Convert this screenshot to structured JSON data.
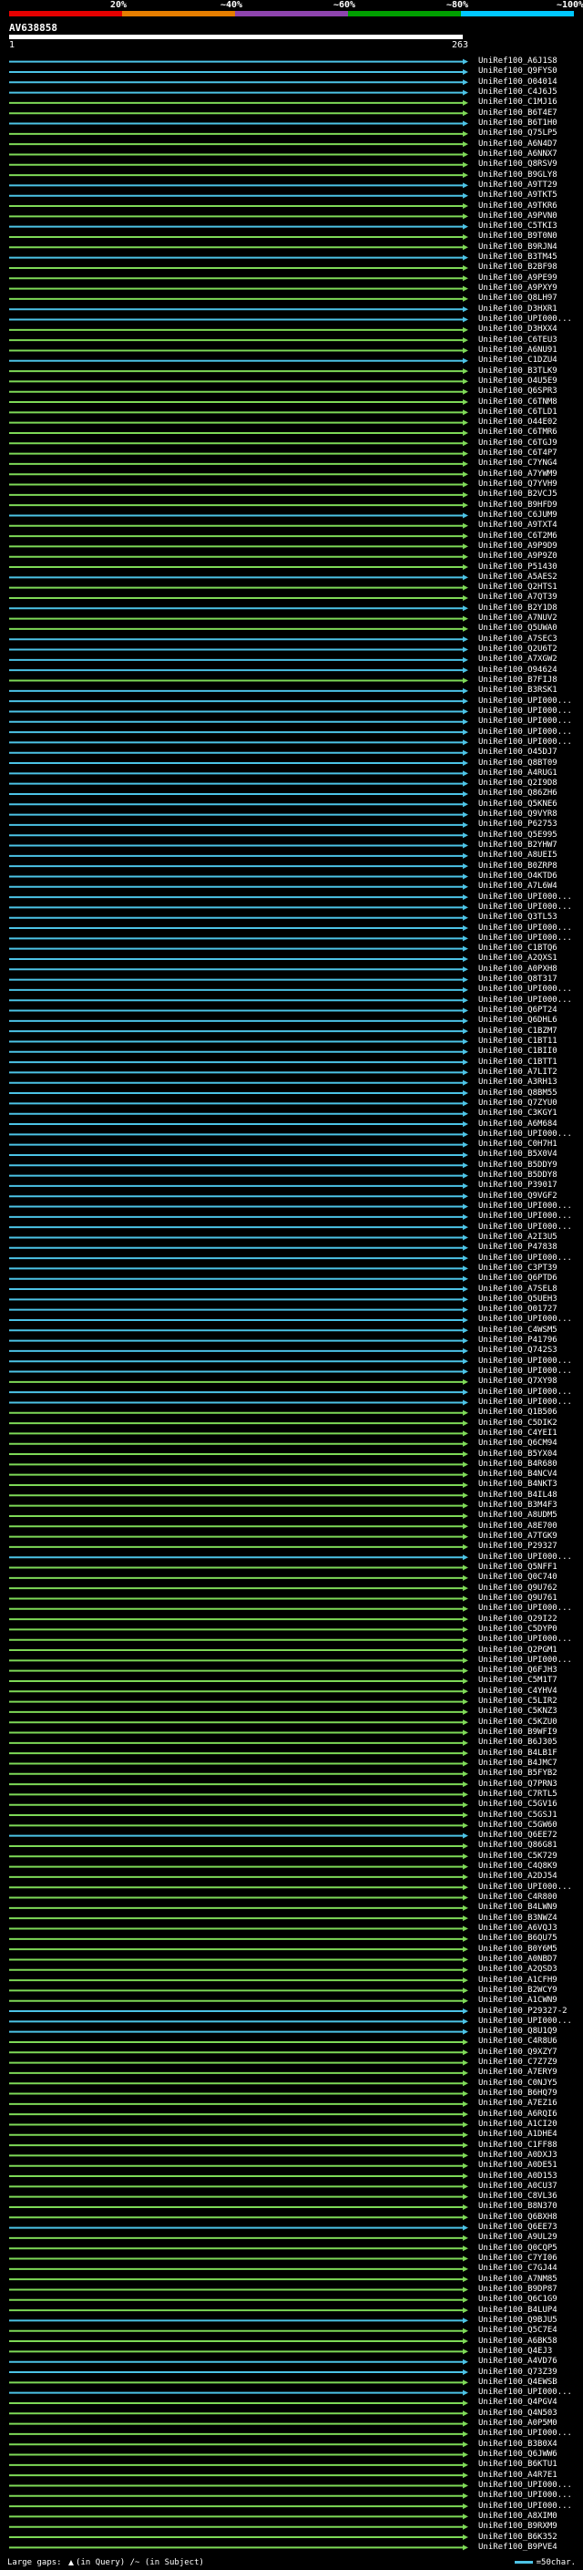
{
  "query": {
    "id": "AV638858",
    "start": "1",
    "end": "263"
  },
  "scale": {
    "ticks": [
      "20%",
      "~40%",
      "~60%",
      "~80%",
      "~100%"
    ],
    "colors": [
      "#e60000",
      "#e67e00",
      "#8e44ad",
      "#00a000",
      "#00c8ff"
    ]
  },
  "legend": {
    "large_gaps_label": "Large gaps:",
    "in_query": "(in Query)",
    "in_subject": "(in Subject)",
    "separator": "/~",
    "scale_text": "=50char."
  },
  "colors": {
    "green": "#7ed957",
    "cyan": "#4cc3e6",
    "white": "#ffffff",
    "background": "#000000"
  },
  "hits": [
    {
      "label": "UniRef100_A6J1S8",
      "color": "cyan"
    },
    {
      "label": "UniRef100_Q9FYS0",
      "color": "cyan"
    },
    {
      "label": "UniRef100_O04014",
      "color": "cyan"
    },
    {
      "label": "UniRef100_C4J6J5",
      "color": "cyan"
    },
    {
      "label": "UniRef100_C1MJ16",
      "color": "green"
    },
    {
      "label": "UniRef100_B6T4E7",
      "color": "green"
    },
    {
      "label": "UniRef100_B6T1H0",
      "color": "cyan"
    },
    {
      "label": "UniRef100_Q75LP5",
      "color": "green"
    },
    {
      "label": "UniRef100_A6N4D7",
      "color": "green"
    },
    {
      "label": "UniRef100_A6NNX7",
      "color": "green"
    },
    {
      "label": "UniRef100_Q8RSV9",
      "color": "green"
    },
    {
      "label": "UniRef100_B9GLY8",
      "color": "green"
    },
    {
      "label": "UniRef100_A9TT29",
      "color": "cyan"
    },
    {
      "label": "UniRef100_A9TKT5",
      "color": "cyan"
    },
    {
      "label": "UniRef100_A9TKR6",
      "color": "green"
    },
    {
      "label": "UniRef100_A9PVN0",
      "color": "green"
    },
    {
      "label": "UniRef100_C5TKI3",
      "color": "cyan"
    },
    {
      "label": "UniRef100_B9T0N0",
      "color": "green"
    },
    {
      "label": "UniRef100_B9RJN4",
      "color": "green"
    },
    {
      "label": "UniRef100_B3TM45",
      "color": "cyan"
    },
    {
      "label": "UniRef100_B2BF98",
      "color": "green"
    },
    {
      "label": "UniRef100_A9PE99",
      "color": "green"
    },
    {
      "label": "UniRef100_A9PXY9",
      "color": "green"
    },
    {
      "label": "UniRef100_Q8LH97",
      "color": "green"
    },
    {
      "label": "UniRef100_D3HXR1",
      "color": "cyan"
    },
    {
      "label": "UniRef100_UPI000...",
      "color": "cyan"
    },
    {
      "label": "UniRef100_D3HXX4",
      "color": "green"
    },
    {
      "label": "UniRef100_C6TEU3",
      "color": "green"
    },
    {
      "label": "UniRef100_A6NU91",
      "color": "green"
    },
    {
      "label": "UniRef100_C1DZU4",
      "color": "cyan"
    },
    {
      "label": "UniRef100_B3TLK9",
      "color": "green"
    },
    {
      "label": "UniRef100_O4U5E9",
      "color": "green"
    },
    {
      "label": "UniRef100_Q6SPR3",
      "color": "green"
    },
    {
      "label": "UniRef100_C6TNM8",
      "color": "green"
    },
    {
      "label": "UniRef100_C6TLD1",
      "color": "green"
    },
    {
      "label": "UniRef100_O44E02",
      "color": "green"
    },
    {
      "label": "UniRef100_C6TMR6",
      "color": "green"
    },
    {
      "label": "UniRef100_C6TGJ9",
      "color": "green"
    },
    {
      "label": "UniRef100_C6T4P7",
      "color": "green"
    },
    {
      "label": "UniRef100_C7YNG4",
      "color": "green"
    },
    {
      "label": "UniRef100_A7YWM9",
      "color": "green"
    },
    {
      "label": "UniRef100_Q7YVH9",
      "color": "green"
    },
    {
      "label": "UniRef100_B2VCJ5",
      "color": "green"
    },
    {
      "label": "UniRef100_B9HFD9",
      "color": "green"
    },
    {
      "label": "UniRef100_C6JUM9",
      "color": "cyan"
    },
    {
      "label": "UniRef100_A9TXT4",
      "color": "green"
    },
    {
      "label": "UniRef100_C6T2M6",
      "color": "green"
    },
    {
      "label": "UniRef100_A9P9D9",
      "color": "green"
    },
    {
      "label": "UniRef100_A9P9Z0",
      "color": "green"
    },
    {
      "label": "UniRef100_P51430",
      "color": "green"
    },
    {
      "label": "UniRef100_A5AES2",
      "color": "cyan"
    },
    {
      "label": "UniRef100_Q2HTS1",
      "color": "green"
    },
    {
      "label": "UniRef100_A7QT39",
      "color": "green"
    },
    {
      "label": "UniRef100_B2Y1D8",
      "color": "cyan"
    },
    {
      "label": "UniRef100_A7NUV2",
      "color": "green"
    },
    {
      "label": "UniRef100_Q5UWA0",
      "color": "green"
    },
    {
      "label": "UniRef100_A7SEC3",
      "color": "cyan"
    },
    {
      "label": "UniRef100_Q2U6T2",
      "color": "cyan"
    },
    {
      "label": "UniRef100_A7XGW2",
      "color": "cyan"
    },
    {
      "label": "UniRef100_O94624",
      "color": "cyan"
    },
    {
      "label": "UniRef100_B7FIJ8",
      "color": "green"
    },
    {
      "label": "UniRef100_B3RSK1",
      "color": "cyan"
    },
    {
      "label": "UniRef100_UPI000...",
      "color": "cyan"
    },
    {
      "label": "UniRef100_UPI000...",
      "color": "cyan"
    },
    {
      "label": "UniRef100_UPI000...",
      "color": "cyan"
    },
    {
      "label": "UniRef100_UPI000...",
      "color": "cyan"
    },
    {
      "label": "UniRef100_UPI000...",
      "color": "cyan"
    },
    {
      "label": "UniRef100_O45DJ7",
      "color": "cyan"
    },
    {
      "label": "UniRef100_Q8BT09",
      "color": "cyan"
    },
    {
      "label": "UniRef100_A4RUG1",
      "color": "cyan"
    },
    {
      "label": "UniRef100_Q2I9D8",
      "color": "cyan"
    },
    {
      "label": "UniRef100_Q86ZH6",
      "color": "cyan"
    },
    {
      "label": "UniRef100_Q5KNE6",
      "color": "cyan"
    },
    {
      "label": "UniRef100_Q9VYR8",
      "color": "cyan"
    },
    {
      "label": "UniRef100_P62753",
      "color": "cyan"
    },
    {
      "label": "UniRef100_Q5E995",
      "color": "cyan"
    },
    {
      "label": "UniRef100_B2YHW7",
      "color": "cyan"
    },
    {
      "label": "UniRef100_A8UEI5",
      "color": "cyan"
    },
    {
      "label": "UniRef100_B0ZRP8",
      "color": "cyan"
    },
    {
      "label": "UniRef100_O4KTD6",
      "color": "cyan"
    },
    {
      "label": "UniRef100_A7L6W4",
      "color": "cyan"
    },
    {
      "label": "UniRef100_UPI000...",
      "color": "cyan"
    },
    {
      "label": "UniRef100_UPI000...",
      "color": "cyan"
    },
    {
      "label": "UniRef100_Q3TL53",
      "color": "cyan"
    },
    {
      "label": "UniRef100_UPI000...",
      "color": "cyan"
    },
    {
      "label": "UniRef100_UPI000...",
      "color": "cyan"
    },
    {
      "label": "UniRef100_C1BTQ6",
      "color": "cyan"
    },
    {
      "label": "UniRef100_A2QXS1",
      "color": "cyan"
    },
    {
      "label": "UniRef100_A0PXH8",
      "color": "cyan"
    },
    {
      "label": "UniRef100_Q8T317",
      "color": "cyan"
    },
    {
      "label": "UniRef100_UPI000...",
      "color": "cyan"
    },
    {
      "label": "UniRef100_UPI000...",
      "color": "cyan"
    },
    {
      "label": "UniRef100_Q6PT24",
      "color": "cyan"
    },
    {
      "label": "UniRef100_Q6DHL6",
      "color": "cyan"
    },
    {
      "label": "UniRef100_C1BZM7",
      "color": "cyan"
    },
    {
      "label": "UniRef100_C1BT11",
      "color": "cyan"
    },
    {
      "label": "UniRef100_C1BII0",
      "color": "cyan"
    },
    {
      "label": "UniRef100_C1BTT1",
      "color": "cyan"
    },
    {
      "label": "UniRef100_A7LIT2",
      "color": "cyan"
    },
    {
      "label": "UniRef100_A3RH13",
      "color": "cyan"
    },
    {
      "label": "UniRef100_Q8BM55",
      "color": "cyan"
    },
    {
      "label": "UniRef100_Q7ZYU0",
      "color": "cyan"
    },
    {
      "label": "UniRef100_C3KGY1",
      "color": "cyan"
    },
    {
      "label": "UniRef100_A6M684",
      "color": "cyan"
    },
    {
      "label": "UniRef100_UPI000...",
      "color": "cyan"
    },
    {
      "label": "UniRef100_C0H7H1",
      "color": "cyan"
    },
    {
      "label": "UniRef100_B5X0V4",
      "color": "cyan"
    },
    {
      "label": "UniRef100_B5DDY9",
      "color": "cyan"
    },
    {
      "label": "UniRef100_B5DDY8",
      "color": "cyan"
    },
    {
      "label": "UniRef100_P39017",
      "color": "cyan"
    },
    {
      "label": "UniRef100_Q9VGF2",
      "color": "cyan"
    },
    {
      "label": "UniRef100_UPI000...",
      "color": "cyan"
    },
    {
      "label": "UniRef100_UPI000...",
      "color": "cyan"
    },
    {
      "label": "UniRef100_UPI000...",
      "color": "cyan"
    },
    {
      "label": "UniRef100_A2I3U5",
      "color": "cyan"
    },
    {
      "label": "UniRef100_P47838",
      "color": "cyan"
    },
    {
      "label": "UniRef100_UPI000...",
      "color": "cyan"
    },
    {
      "label": "UniRef100_C3PT39",
      "color": "cyan"
    },
    {
      "label": "UniRef100_Q6PTD6",
      "color": "cyan"
    },
    {
      "label": "UniRef100_A7SEL8",
      "color": "cyan"
    },
    {
      "label": "UniRef100_Q5UEH3",
      "color": "cyan"
    },
    {
      "label": "UniRef100_O01727",
      "color": "cyan"
    },
    {
      "label": "UniRef100_UPI000...",
      "color": "cyan"
    },
    {
      "label": "UniRef100_C4WSM5",
      "color": "cyan"
    },
    {
      "label": "UniRef100_P41796",
      "color": "cyan"
    },
    {
      "label": "UniRef100_Q742S3",
      "color": "cyan"
    },
    {
      "label": "UniRef100_UPI000...",
      "color": "cyan"
    },
    {
      "label": "UniRef100_UPI000...",
      "color": "cyan"
    },
    {
      "label": "UniRef100_Q7XY98",
      "color": "green"
    },
    {
      "label": "UniRef100_UPI000...",
      "color": "cyan"
    },
    {
      "label": "UniRef100_UPI000...",
      "color": "cyan"
    },
    {
      "label": "UniRef100_Q1B506",
      "color": "green"
    },
    {
      "label": "UniRef100_C5DIK2",
      "color": "green"
    },
    {
      "label": "UniRef100_C4YEI1",
      "color": "green"
    },
    {
      "label": "UniRef100_Q6CM94",
      "color": "green"
    },
    {
      "label": "UniRef100_B5YX04",
      "color": "green"
    },
    {
      "label": "UniRef100_B4R680",
      "color": "green"
    },
    {
      "label": "UniRef100_B4NCV4",
      "color": "green"
    },
    {
      "label": "UniRef100_B4NKT3",
      "color": "green"
    },
    {
      "label": "UniRef100_B4IL48",
      "color": "green"
    },
    {
      "label": "UniRef100_B3M4F3",
      "color": "green"
    },
    {
      "label": "UniRef100_A8UDM5",
      "color": "green"
    },
    {
      "label": "UniRef100_A8E700",
      "color": "green"
    },
    {
      "label": "UniRef100_A7TGK9",
      "color": "green"
    },
    {
      "label": "UniRef100_P29327",
      "color": "green"
    },
    {
      "label": "UniRef100_UPI000...",
      "color": "cyan"
    },
    {
      "label": "UniRef100_Q5NFF1",
      "color": "green"
    },
    {
      "label": "UniRef100_Q0C740",
      "color": "green"
    },
    {
      "label": "UniRef100_Q9U762",
      "color": "green"
    },
    {
      "label": "UniRef100_Q9U761",
      "color": "green"
    },
    {
      "label": "UniRef100_UPI000...",
      "color": "green"
    },
    {
      "label": "UniRef100_Q29I22",
      "color": "green"
    },
    {
      "label": "UniRef100_C5DYP0",
      "color": "green"
    },
    {
      "label": "UniRef100_UPI000...",
      "color": "green"
    },
    {
      "label": "UniRef100_Q2PGM1",
      "color": "green"
    },
    {
      "label": "UniRef100_UPI000...",
      "color": "green"
    },
    {
      "label": "UniRef100_Q6FJH3",
      "color": "green"
    },
    {
      "label": "UniRef100_C5M1T7",
      "color": "green"
    },
    {
      "label": "UniRef100_C4YHV4",
      "color": "green"
    },
    {
      "label": "UniRef100_C5LIR2",
      "color": "green"
    },
    {
      "label": "UniRef100_C5KNZ3",
      "color": "green"
    },
    {
      "label": "UniRef100_C5KZU0",
      "color": "green"
    },
    {
      "label": "UniRef100_B9WFI9",
      "color": "green"
    },
    {
      "label": "UniRef100_B6J305",
      "color": "green"
    },
    {
      "label": "UniRef100_B4LB1F",
      "color": "green"
    },
    {
      "label": "UniRef100_B4JMC7",
      "color": "green"
    },
    {
      "label": "UniRef100_B5FYB2",
      "color": "green"
    },
    {
      "label": "UniRef100_Q7PRN3",
      "color": "green"
    },
    {
      "label": "UniRef100_C7RTL5",
      "color": "green"
    },
    {
      "label": "UniRef100_C5GV16",
      "color": "green"
    },
    {
      "label": "UniRef100_C5GSJ1",
      "color": "green"
    },
    {
      "label": "UniRef100_C5GW60",
      "color": "green"
    },
    {
      "label": "UniRef100_Q6EE72",
      "color": "cyan"
    },
    {
      "label": "UniRef100_Q86G81",
      "color": "green"
    },
    {
      "label": "UniRef100_C5K729",
      "color": "green"
    },
    {
      "label": "UniRef100_C4Q8K9",
      "color": "green"
    },
    {
      "label": "UniRef100_A2DJ54",
      "color": "green"
    },
    {
      "label": "UniRef100_UPI000...",
      "color": "green"
    },
    {
      "label": "UniRef100_C4R800",
      "color": "green"
    },
    {
      "label": "UniRef100_B4LWN9",
      "color": "green"
    },
    {
      "label": "UniRef100_B3NWZ4",
      "color": "green"
    },
    {
      "label": "UniRef100_A6VQJ3",
      "color": "green"
    },
    {
      "label": "UniRef100_B6QU75",
      "color": "green"
    },
    {
      "label": "UniRef100_B0Y6M5",
      "color": "green"
    },
    {
      "label": "UniRef100_A0NBD7",
      "color": "green"
    },
    {
      "label": "UniRef100_A2QSD3",
      "color": "green"
    },
    {
      "label": "UniRef100_A1CFH9",
      "color": "green"
    },
    {
      "label": "UniRef100_B2WCY9",
      "color": "green"
    },
    {
      "label": "UniRef100_A1CWN9",
      "color": "green"
    },
    {
      "label": "UniRef100_P29327-2",
      "color": "cyan"
    },
    {
      "label": "UniRef100_UPI000...",
      "color": "cyan"
    },
    {
      "label": "UniRef100_Q8U1Q9",
      "color": "cyan"
    },
    {
      "label": "UniRef100_C4R8U6",
      "color": "green"
    },
    {
      "label": "UniRef100_Q9XZY7",
      "color": "green"
    },
    {
      "label": "UniRef100_C7Z7Z9",
      "color": "green"
    },
    {
      "label": "UniRef100_A7ERY9",
      "color": "green"
    },
    {
      "label": "UniRef100_C0NJY5",
      "color": "green"
    },
    {
      "label": "UniRef100_B6HQ79",
      "color": "green"
    },
    {
      "label": "UniRef100_A7EZ16",
      "color": "green"
    },
    {
      "label": "UniRef100_A6RQI6",
      "color": "green"
    },
    {
      "label": "UniRef100_A1CI20",
      "color": "green"
    },
    {
      "label": "UniRef100_A1DHE4",
      "color": "green"
    },
    {
      "label": "UniRef100_C1FF88",
      "color": "green"
    },
    {
      "label": "UniRef100_A0DXJ3",
      "color": "green"
    },
    {
      "label": "UniRef100_A0DE51",
      "color": "green"
    },
    {
      "label": "UniRef100_A0D153",
      "color": "green"
    },
    {
      "label": "UniRef100_A0CU37",
      "color": "green"
    },
    {
      "label": "UniRef100_C8VL36",
      "color": "green"
    },
    {
      "label": "UniRef100_B8N370",
      "color": "green"
    },
    {
      "label": "UniRef100_Q6BXH8",
      "color": "green"
    },
    {
      "label": "UniRef100_Q6EE73",
      "color": "cyan"
    },
    {
      "label": "UniRef100_A9UL29",
      "color": "green"
    },
    {
      "label": "UniRef100_Q0CQP5",
      "color": "green"
    },
    {
      "label": "UniRef100_C7YI06",
      "color": "green"
    },
    {
      "label": "UniRef100_C7GJ44",
      "color": "green"
    },
    {
      "label": "UniRef100_A7NM85",
      "color": "green"
    },
    {
      "label": "UniRef100_B9DP87",
      "color": "green"
    },
    {
      "label": "UniRef100_Q6C1G9",
      "color": "green"
    },
    {
      "label": "UniRef100_B4LUP4",
      "color": "green"
    },
    {
      "label": "UniRef100_Q9BJU5",
      "color": "cyan"
    },
    {
      "label": "UniRef100_Q5C7E4",
      "color": "green"
    },
    {
      "label": "UniRef100_A6BK58",
      "color": "green"
    },
    {
      "label": "UniRef100_Q4EJ3",
      "color": "green"
    },
    {
      "label": "UniRef100_A4VD76",
      "color": "cyan"
    },
    {
      "label": "UniRef100_Q73Z39",
      "color": "cyan"
    },
    {
      "label": "UniRef100_Q4EWSB",
      "color": "green"
    },
    {
      "label": "UniRef100_UPI000...",
      "color": "cyan"
    },
    {
      "label": "UniRef100_Q4PGV4",
      "color": "green"
    },
    {
      "label": "UniRef100_Q4N503",
      "color": "green"
    },
    {
      "label": "UniRef100_A0P5M0",
      "color": "green"
    },
    {
      "label": "UniRef100_UPI000...",
      "color": "green"
    },
    {
      "label": "UniRef100_B3B0X4",
      "color": "green"
    },
    {
      "label": "UniRef100_Q6JWW6",
      "color": "green"
    },
    {
      "label": "UniRef100_B6KTU1",
      "color": "green"
    },
    {
      "label": "UniRef100_A4R7E1",
      "color": "green"
    },
    {
      "label": "UniRef100_UPI000...",
      "color": "green"
    },
    {
      "label": "UniRef100_UPI000...",
      "color": "green"
    },
    {
      "label": "UniRef100_UPI000...",
      "color": "green"
    },
    {
      "label": "UniRef100_A8XIM0",
      "color": "green"
    },
    {
      "label": "UniRef100_B9RXM9",
      "color": "green"
    },
    {
      "label": "UniRef100_B6K352",
      "color": "green"
    },
    {
      "label": "UniRef100_B9PVE4",
      "color": "green"
    }
  ]
}
